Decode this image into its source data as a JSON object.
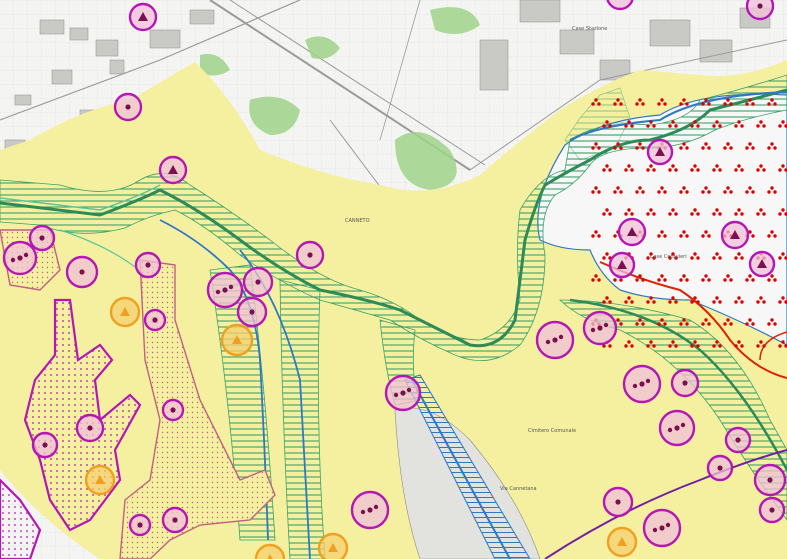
{
  "map": {
    "colors": {
      "background": "#f4f4f2",
      "yellow_zone": "#f5f0a0",
      "green_area": "#9fd38a",
      "stream_dark": "#2e8b57",
      "stream_light": "#5cc59a",
      "hatch_green": "#3aa26a",
      "hatch_blue": "#2f78c4",
      "magenta": "#b417b4",
      "point_fill": "#f0c0d8",
      "triangle": "#7a1050",
      "orange": "#f0a020",
      "red_dot": "#dd0000",
      "red_line": "#e02000",
      "purple_line": "#7020a0",
      "road": "#9a9a9a"
    },
    "labels": {
      "place_north": "Case Stazione",
      "place_right": "Case Cerquieri",
      "place_center": "CANNETO",
      "place_south": "Cimitero Comunale",
      "road_label": "Via Cannetana"
    },
    "symbols": {
      "triangle_site_icon": "triangle-in-circle",
      "dot_site_icon": "dot-in-circle",
      "orange_site_icon": "orange-triangle-site"
    }
  }
}
